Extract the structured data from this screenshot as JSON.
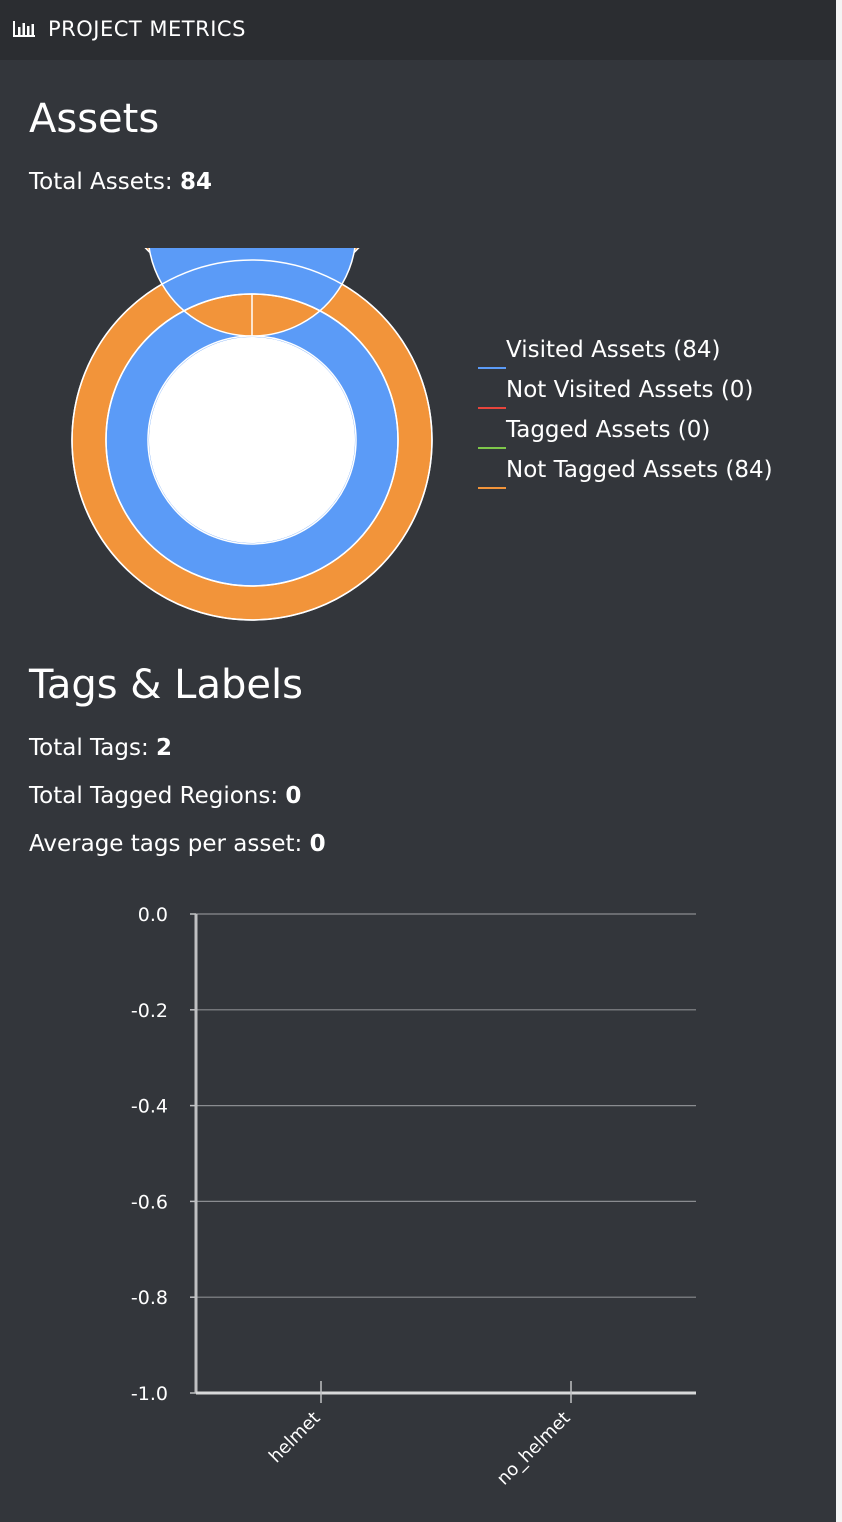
{
  "header": {
    "title": "PROJECT METRICS",
    "icon": "bar-chart-icon"
  },
  "assets": {
    "title": "Assets",
    "total_label": "Total Assets:",
    "total_value": "84",
    "legend": [
      {
        "label": "Visited Assets (84)",
        "color": "#5b9bf7"
      },
      {
        "label": "Not Visited Assets (0)",
        "color": "#e8453c"
      },
      {
        "label": "Tagged Assets (0)",
        "color": "#7ec74a"
      },
      {
        "label": "Not Tagged Assets (84)",
        "color": "#f2943a"
      }
    ]
  },
  "tags": {
    "title": "Tags & Labels",
    "total_tags_label": "Total Tags:",
    "total_tags_value": "2",
    "total_regions_label": "Total Tagged Regions:",
    "total_regions_value": "0",
    "avg_label": "Average tags per asset:",
    "avg_value": "0"
  },
  "chart_data": [
    {
      "type": "pie",
      "rings": [
        {
          "ring": "outer",
          "slices": [
            {
              "label": "Tagged Assets",
              "value": 0,
              "color": "#7ec74a"
            },
            {
              "label": "Not Tagged Assets",
              "value": 84,
              "color": "#f2943a"
            }
          ]
        },
        {
          "ring": "inner",
          "slices": [
            {
              "label": "Visited Assets",
              "value": 84,
              "color": "#5b9bf7"
            },
            {
              "label": "Not Visited Assets",
              "value": 0,
              "color": "#e8453c"
            }
          ]
        }
      ],
      "legend_position": "right"
    },
    {
      "type": "bar",
      "categories": [
        "helmet",
        "no_helmet"
      ],
      "values": [
        0,
        0
      ],
      "ylim": [
        -1.0,
        0.0
      ],
      "yticks": [
        "0.0",
        "-0.2",
        "-0.4",
        "-0.6",
        "-0.8",
        "-1.0"
      ],
      "grid": true,
      "colors": {
        "grid": "#8a8c90",
        "axis": "#bfc0c2",
        "text": "#ffffff"
      }
    }
  ]
}
